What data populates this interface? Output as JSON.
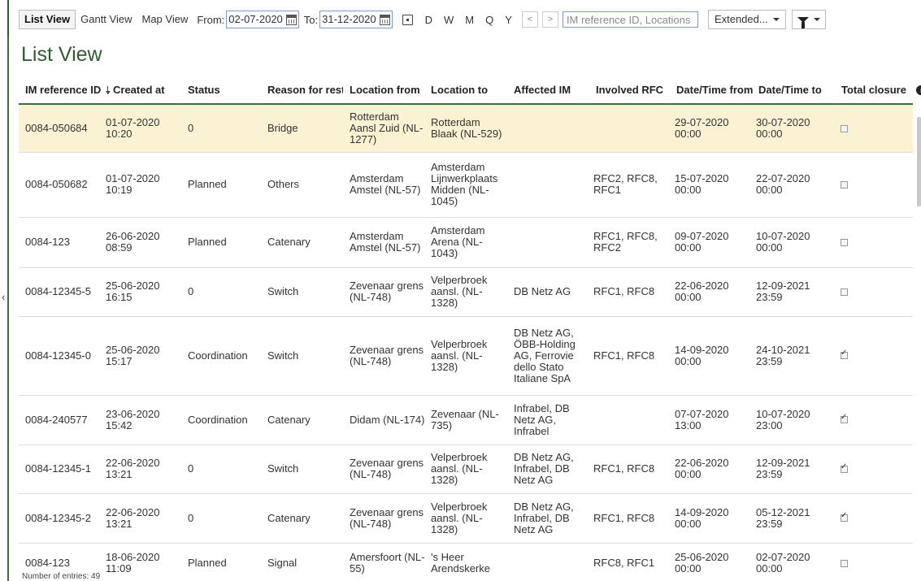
{
  "toolbar": {
    "views": [
      "List View",
      "Gantt View",
      "Map View"
    ],
    "from_label": "From:",
    "from_date": "02-07-2020",
    "to_label": "To:",
    "to_date": "31-12-2020",
    "periods": [
      "D",
      "W",
      "M",
      "Q",
      "Y"
    ],
    "prev": "<",
    "next": ">",
    "search_placeholder": "IM reference ID, Locations",
    "extended_label": "Extended...",
    "icons": [
      "calendar-icon",
      "today-icon",
      "filter-icon",
      "caret-down-icon"
    ]
  },
  "page_title": "List View",
  "table": {
    "headers": [
      "IM reference ID",
      "Created at",
      "Status",
      "Reason for restriction",
      "Location from",
      "Location to",
      "Affected IM",
      "Involved RFC",
      "Date/Time from",
      "Date/Time to",
      "Total closure"
    ],
    "rows": [
      {
        "id": "0084-050684",
        "created": "01-07-2020 10:20",
        "status": "0",
        "reason": "Bridge",
        "loc_from": "Rotterdam Aansl Zuid (NL-1277)",
        "loc_to": "Rotterdam Blaak (NL-529)",
        "affected": "",
        "rfc": "",
        "dt_from": "29-07-2020 00:00",
        "dt_to": "30-07-2020 00:00",
        "closure": false
      },
      {
        "id": "0084-050682",
        "created": "01-07-2020 10:19",
        "status": "Planned",
        "reason": "Others",
        "loc_from": "Amsterdam Amstel (NL-57)",
        "loc_to": "Amsterdam Lijnwerkplaats Midden (NL-1045)",
        "affected": "",
        "rfc": "RFC2, RFC8, RFC1",
        "dt_from": "15-07-2020 00:00",
        "dt_to": "22-07-2020 00:00",
        "closure": false
      },
      {
        "id": "0084-123",
        "created": "26-06-2020 08:59",
        "status": "Planned",
        "reason": "Catenary",
        "loc_from": "Amsterdam Amstel (NL-57)",
        "loc_to": "Amsterdam Arena (NL-1043)",
        "affected": "",
        "rfc": "RFC1, RFC8, RFC2",
        "dt_from": "09-07-2020 00:00",
        "dt_to": "10-07-2020 00:00",
        "closure": false
      },
      {
        "id": "0084-12345-5",
        "created": "25-06-2020 16:15",
        "status": "0",
        "reason": "Switch",
        "loc_from": "Zevenaar grens (NL-748)",
        "loc_to": "Velperbroek aansl. (NL-1328)",
        "affected": "DB Netz AG",
        "rfc": "RFC1, RFC8",
        "dt_from": "22-06-2020 00:00",
        "dt_to": "12-09-2021 23:59",
        "closure": false
      },
      {
        "id": "0084-12345-0",
        "created": "25-06-2020 15:17",
        "status": "Coordination",
        "reason": "Switch",
        "loc_from": "Zevenaar grens (NL-748)",
        "loc_to": "Velperbroek aansl. (NL-1328)",
        "affected": "DB Netz AG, ÖBB-Holding AG, Ferrovie dello Stato Italiane SpA",
        "rfc": "RFC1, RFC8",
        "dt_from": "14-09-2020 00:00",
        "dt_to": "24-10-2021 23:59",
        "closure": true
      },
      {
        "id": "0084-240577",
        "created": "23-06-2020 15:42",
        "status": "Coordination",
        "reason": "Catenary",
        "loc_from": "Didam (NL-174)",
        "loc_to": "Zevenaar (NL-735)",
        "affected": "Infrabel, DB Netz AG, Infrabel",
        "rfc": "",
        "dt_from": "07-07-2020 13:00",
        "dt_to": "10-07-2020 23:00",
        "closure": true
      },
      {
        "id": "0084-12345-1",
        "created": "22-06-2020 13:21",
        "status": "0",
        "reason": "Switch",
        "loc_from": "Zevenaar grens (NL-748)",
        "loc_to": "Velperbroek aansl. (NL-1328)",
        "affected": "DB Netz AG, Infrabel, DB Netz AG",
        "rfc": "RFC1, RFC8",
        "dt_from": "22-06-2020 00:00",
        "dt_to": "12-09-2021 23:59",
        "closure": true
      },
      {
        "id": "0084-12345-2",
        "created": "22-06-2020 13:21",
        "status": "0",
        "reason": "Catenary",
        "loc_from": "Zevenaar grens (NL-748)",
        "loc_to": "Velperbroek aansl. (NL-1328)",
        "affected": "DB Netz AG, Infrabel, DB Netz AG",
        "rfc": "RFC1, RFC8",
        "dt_from": "14-09-2020 00:00",
        "dt_to": "05-12-2021 23:59",
        "closure": true
      },
      {
        "id": "0084-123",
        "created": "18-06-2020 11:09",
        "status": "Planned",
        "reason": "Signal",
        "loc_from": "Amersfoort (NL-55)",
        "loc_to": "'s Heer Arendskerke",
        "affected": "",
        "rfc": "RFC8, RFC1",
        "dt_from": "25-06-2020 00:00",
        "dt_to": "02-07-2020 00:00",
        "closure": false
      }
    ]
  },
  "footer": {
    "entries_label": "Number of entries:",
    "entries_count": "49"
  },
  "colors": {
    "accent": "#2f5e2f",
    "highlight_row": "#fbf1d3",
    "input_border": "#7a9cc6"
  }
}
